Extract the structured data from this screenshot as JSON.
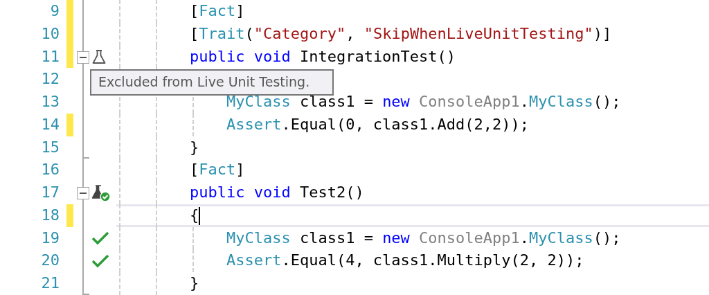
{
  "editor": {
    "lines": [
      {
        "number": "9",
        "changed": true,
        "kind": "plain",
        "fold_end": false,
        "tokens": [
          {
            "kind": "punct",
            "text": "        ["
          },
          {
            "kind": "type",
            "text": "Fact"
          },
          {
            "kind": "punct",
            "text": "]"
          }
        ]
      },
      {
        "number": "10",
        "changed": true,
        "kind": "plain",
        "fold_end": false,
        "tokens": [
          {
            "kind": "punct",
            "text": "        ["
          },
          {
            "kind": "type",
            "text": "Trait"
          },
          {
            "kind": "punct",
            "text": "("
          },
          {
            "kind": "string",
            "text": "\"Category\""
          },
          {
            "kind": "punct",
            "text": ", "
          },
          {
            "kind": "string",
            "text": "\"SkipWhenLiveUnitTesting\""
          },
          {
            "kind": "punct",
            "text": ")]"
          }
        ]
      },
      {
        "number": "11",
        "changed": true,
        "kind": "excluded-test",
        "fold_end": false,
        "expanded": true,
        "tokens": [
          {
            "kind": "keyword",
            "text": "        public void"
          },
          {
            "kind": "punct",
            "text": " IntegrationTest()"
          }
        ]
      },
      {
        "number": "12",
        "changed": false,
        "kind": "plain",
        "fold_end": false
      },
      {
        "number": "13",
        "changed": false,
        "kind": "plain",
        "fold_end": false,
        "tokens": [
          {
            "kind": "type",
            "text": "            MyClass"
          },
          {
            "kind": "punct",
            "text": " class1 = "
          },
          {
            "kind": "keyword",
            "text": "new "
          },
          {
            "kind": "namespace",
            "text": "ConsoleApp1"
          },
          {
            "kind": "punct",
            "text": "."
          },
          {
            "kind": "type",
            "text": "MyClass"
          },
          {
            "kind": "punct",
            "text": "();"
          }
        ]
      },
      {
        "number": "14",
        "changed": true,
        "kind": "plain",
        "fold_end": false,
        "tokens": [
          {
            "kind": "type",
            "text": "            Assert"
          },
          {
            "kind": "punct",
            "text": ".Equal(0, class1.Add(2,2));"
          }
        ]
      },
      {
        "number": "15",
        "changed": false,
        "kind": "plain",
        "fold_end": true,
        "tokens": [
          {
            "kind": "punct",
            "text": "        }"
          }
        ]
      },
      {
        "number": "16",
        "changed": false,
        "kind": "plain",
        "fold_end": false,
        "tokens": [
          {
            "kind": "punct",
            "text": "        ["
          },
          {
            "kind": "type",
            "text": "Fact"
          },
          {
            "kind": "punct",
            "text": "]"
          }
        ]
      },
      {
        "number": "17",
        "changed": false,
        "kind": "passed-test",
        "fold_end": false,
        "expanded": true,
        "tokens": [
          {
            "kind": "keyword",
            "text": "        public void"
          },
          {
            "kind": "punct",
            "text": " Test2()"
          }
        ]
      },
      {
        "number": "18",
        "changed": true,
        "kind": "plain",
        "fold_end": false,
        "current": true,
        "tokens": [
          {
            "kind": "punct",
            "text": "        {"
          }
        ]
      },
      {
        "number": "19",
        "changed": false,
        "kind": "covered",
        "fold_end": false,
        "tokens": [
          {
            "kind": "type",
            "text": "            MyClass"
          },
          {
            "kind": "punct",
            "text": " class1 = "
          },
          {
            "kind": "keyword",
            "text": "new "
          },
          {
            "kind": "namespace",
            "text": "ConsoleApp1"
          },
          {
            "kind": "punct",
            "text": "."
          },
          {
            "kind": "type",
            "text": "MyClass"
          },
          {
            "kind": "punct",
            "text": "();"
          }
        ]
      },
      {
        "number": "20",
        "changed": false,
        "kind": "covered",
        "fold_end": false,
        "tokens": [
          {
            "kind": "type",
            "text": "            Assert"
          },
          {
            "kind": "punct",
            "text": ".Equal(4, class1.Multiply(2, 2));"
          }
        ]
      },
      {
        "number": "21",
        "changed": false,
        "kind": "plain",
        "fold_end": true,
        "tokens": [
          {
            "kind": "punct",
            "text": "        }"
          }
        ]
      }
    ]
  },
  "tooltip": {
    "text": "Excluded from Live Unit Testing."
  }
}
